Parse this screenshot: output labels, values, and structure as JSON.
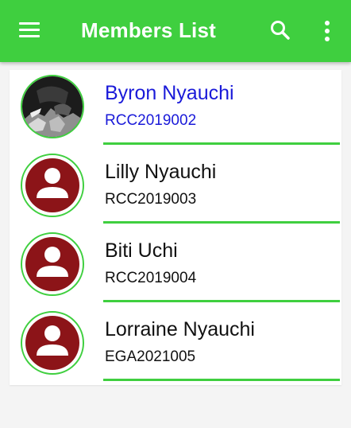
{
  "app_bar": {
    "title": "Members List",
    "menu_icon": "hamburger-menu-icon",
    "search_icon": "search-icon",
    "overflow_icon": "more-vertical-icon",
    "color": "#3fcf3f"
  },
  "colors": {
    "accent": "#3fcf3f",
    "selected_text": "#1a1ad9",
    "avatar_fill": "#8c1418"
  },
  "members": [
    {
      "name": "Byron Nyauchi",
      "code": "RCC2019002",
      "avatar": "photo",
      "selected": true
    },
    {
      "name": "Lilly Nyauchi",
      "code": "RCC2019003",
      "avatar": "default-person-icon",
      "selected": false
    },
    {
      "name": "Biti Uchi",
      "code": "RCC2019004",
      "avatar": "default-person-icon",
      "selected": false
    },
    {
      "name": "Lorraine Nyauchi",
      "code": "EGA2021005",
      "avatar": "default-person-icon",
      "selected": false
    }
  ]
}
